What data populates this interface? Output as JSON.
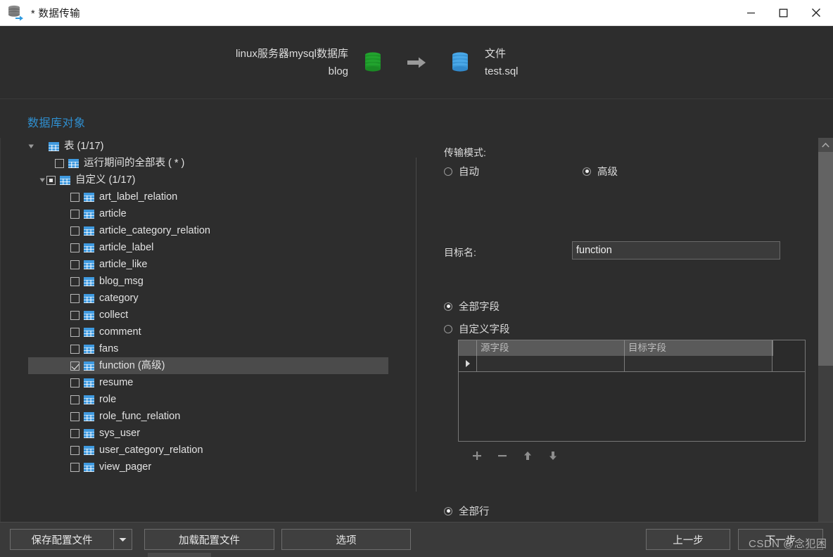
{
  "window": {
    "title": "* 数据传输",
    "icon": "database-transfer-icon",
    "controls": {
      "minimize": "minimize-icon",
      "maximize": "maximize-icon",
      "close": "close-icon"
    }
  },
  "header": {
    "source": {
      "line1": "linux服务器mysql数据库",
      "line2": "blog",
      "icon": "green-database-icon",
      "color": "#1faa32"
    },
    "arrow": "right-arrow-icon",
    "target": {
      "line1": "文件",
      "line2": "test.sql",
      "icon": "blue-database-icon",
      "color": "#3d9ae0"
    }
  },
  "section": {
    "title": "数据库对象",
    "title_color": "#2f8fd0"
  },
  "tree": {
    "root": {
      "label": "表 (1/17)",
      "expanded": true,
      "checkbox": "none"
    },
    "all_tables": {
      "label": "运行期间的全部表 ( * )",
      "checked": false
    },
    "custom": {
      "label": "自定义 (1/17)",
      "expanded": true,
      "checkstate": "partial"
    },
    "items": [
      {
        "label": "art_label_relation",
        "checked": false,
        "selected": false
      },
      {
        "label": "article",
        "checked": false,
        "selected": false
      },
      {
        "label": "article_category_relation",
        "checked": false,
        "selected": false
      },
      {
        "label": "article_label",
        "checked": false,
        "selected": false
      },
      {
        "label": "article_like",
        "checked": false,
        "selected": false
      },
      {
        "label": "blog_msg",
        "checked": false,
        "selected": false
      },
      {
        "label": "category",
        "checked": false,
        "selected": false
      },
      {
        "label": "collect",
        "checked": false,
        "selected": false
      },
      {
        "label": "comment",
        "checked": false,
        "selected": false
      },
      {
        "label": "fans",
        "checked": false,
        "selected": false
      },
      {
        "label": "function (高级)",
        "checked": true,
        "selected": true
      },
      {
        "label": "resume",
        "checked": false,
        "selected": false
      },
      {
        "label": "role",
        "checked": false,
        "selected": false
      },
      {
        "label": "role_func_relation",
        "checked": false,
        "selected": false
      },
      {
        "label": "sys_user",
        "checked": false,
        "selected": false
      },
      {
        "label": "user_category_relation",
        "checked": false,
        "selected": false
      },
      {
        "label": "view_pager",
        "checked": false,
        "selected": false
      }
    ]
  },
  "right_panel": {
    "transfer_mode_label": "传输模式:",
    "mode_auto": {
      "label": "自动",
      "selected": false
    },
    "mode_advanced": {
      "label": "高级",
      "selected": true
    },
    "target_name_label": "目标名:",
    "target_name_value": "function",
    "fields_all": {
      "label": "全部字段",
      "selected": true
    },
    "fields_custom": {
      "label": "自定义字段",
      "selected": false
    },
    "grid": {
      "columns": [
        "源字段",
        "目标字段"
      ],
      "rows": [
        {
          "source": "",
          "target": "",
          "indicator": true
        }
      ]
    },
    "grid_tools": [
      {
        "name": "add-field-button",
        "glyph": "+"
      },
      {
        "name": "remove-field-button",
        "glyph": "−"
      },
      {
        "name": "move-up-button",
        "glyph": "↑"
      },
      {
        "name": "move-down-button",
        "glyph": "↓"
      }
    ],
    "rows_all": {
      "label": "全部行",
      "selected": true
    }
  },
  "footer": {
    "save_profile": "保存配置文件",
    "save_profile_dropdown": "chevron-down-icon",
    "load_profile": "加载配置文件",
    "options": "选项",
    "previous": "上一步",
    "next": "下一步"
  },
  "watermark": "CSDN @念犯困"
}
